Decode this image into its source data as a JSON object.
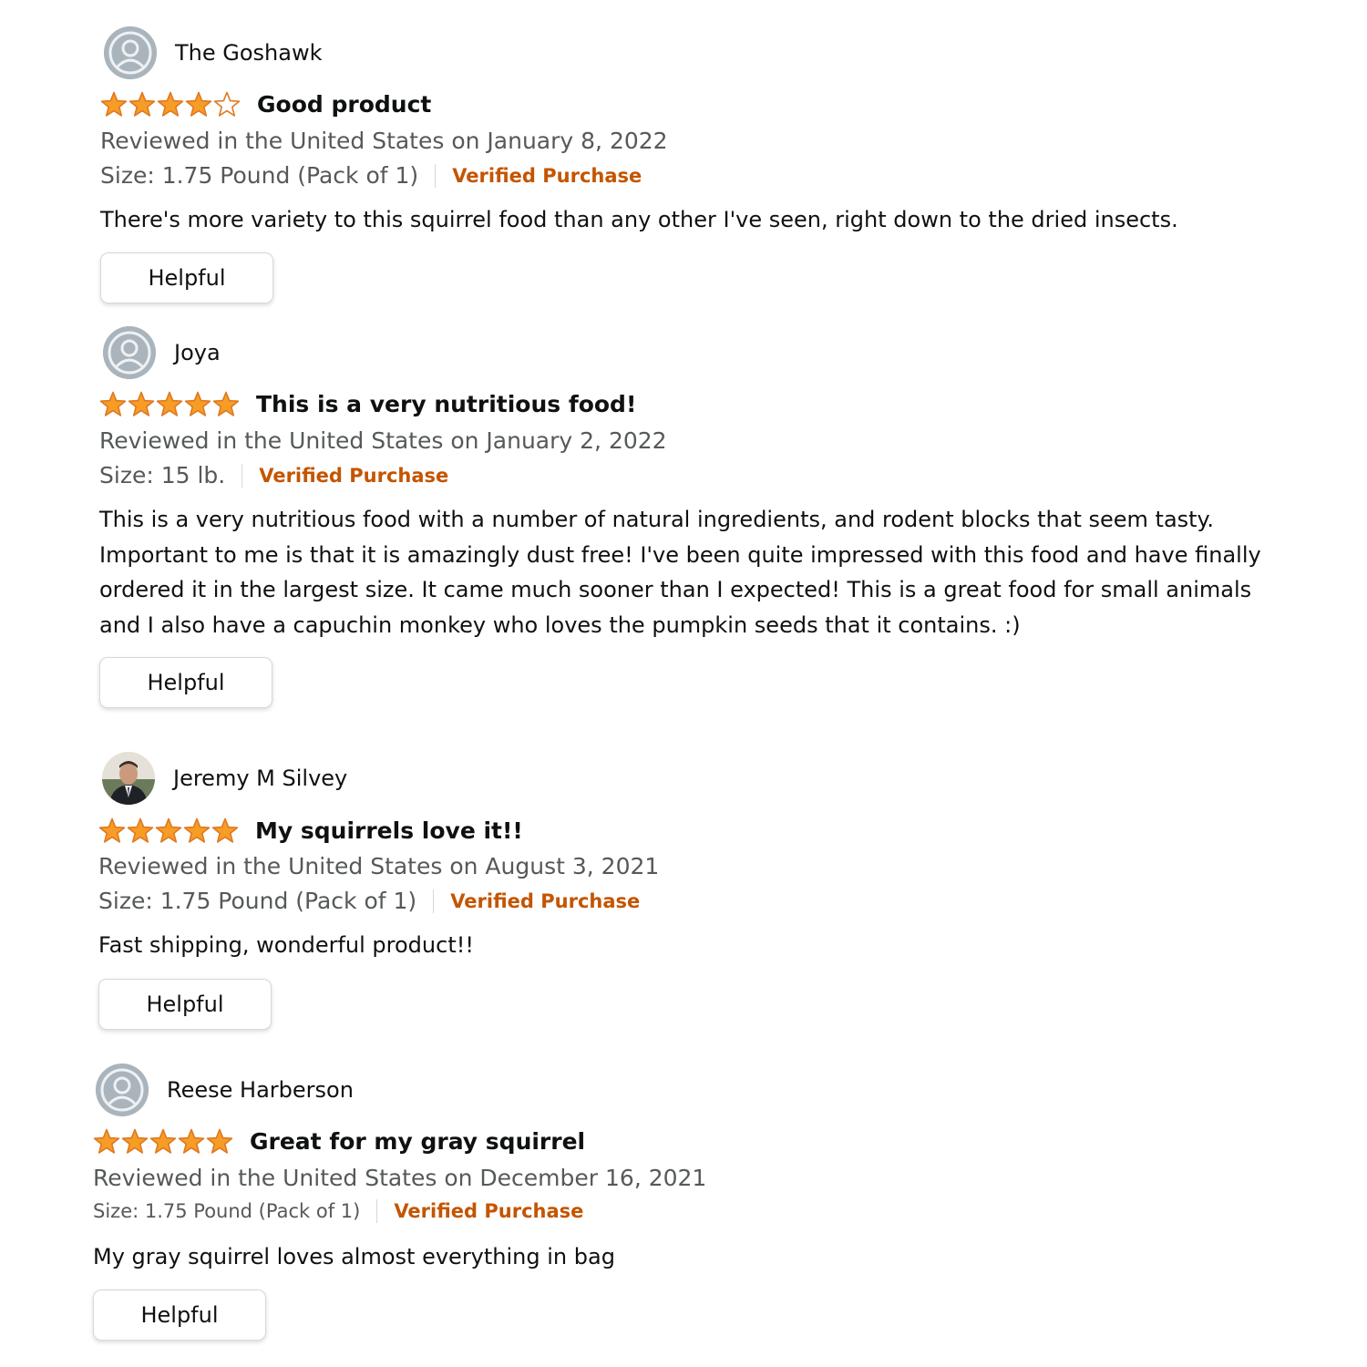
{
  "colors": {
    "star_fill": "#f79c25",
    "star_outline": "#de7921",
    "verified": "#c45500",
    "meta_text": "#565959",
    "body_text": "#0f1111",
    "avatar_bg": "#a9b4bc"
  },
  "reviews": [
    {
      "reviewer": "The Goshawk",
      "avatar": "default-user-icon",
      "rating": 4,
      "title": "Good product",
      "date": "Reviewed in the United States on January 8, 2022",
      "size": "Size: 1.75 Pound (Pack of 1)",
      "verified": "Verified Purchase",
      "body": "There's more variety to this squirrel food than any other I've seen, right down to the dried insects.",
      "helpful": "Helpful"
    },
    {
      "reviewer": "Joya",
      "avatar": "default-user-icon",
      "rating": 5,
      "title": "This is a very nutritious food!",
      "date": "Reviewed in the United States on January 2, 2022",
      "size": "Size: 15 lb.",
      "verified": "Verified Purchase",
      "body": "This is a very nutritious food with a number of natural ingredients, and rodent blocks that seem tasty.\nImportant to me is that it is amazingly dust free! I've been quite impressed with this food and have finally\nordered it in the largest size. It came much sooner than I expected! This is a great food for small animals\nand I also have a capuchin monkey who loves the pumpkin seeds that it contains. :)",
      "helpful": "Helpful"
    },
    {
      "reviewer": "Jeremy M Silvey",
      "avatar": "profile-photo",
      "rating": 5,
      "title": "My squirrels love it!!",
      "date": "Reviewed in the United States on August 3, 2021",
      "size": "Size: 1.75 Pound (Pack of 1)",
      "verified": "Verified Purchase",
      "body": "Fast shipping, wonderful product!!",
      "helpful": "Helpful"
    },
    {
      "reviewer": "Reese Harberson",
      "avatar": "default-user-icon",
      "rating": 5,
      "title": "Great for my gray squirrel",
      "date": "Reviewed in the United States on December 16, 2021",
      "size": "Size: 1.75 Pound (Pack of 1)",
      "verified": "Verified Purchase",
      "body": "My gray squirrel loves almost everything in bag",
      "helpful": "Helpful"
    }
  ]
}
